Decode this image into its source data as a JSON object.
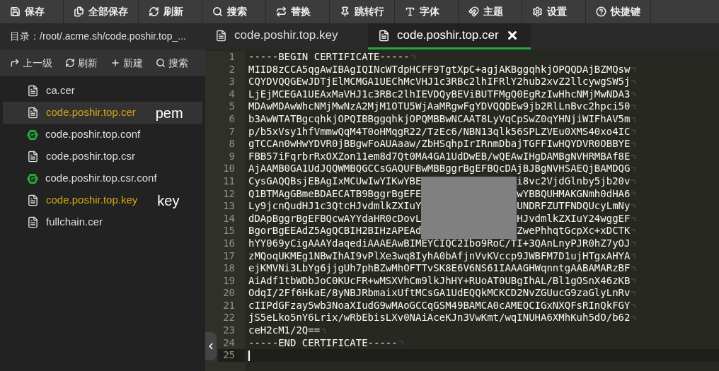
{
  "toolbar": [
    "保存",
    "全部保存",
    "刷新",
    "搜索",
    "替换",
    "跳转行",
    "字体",
    "主题",
    "设置",
    "快捷键"
  ],
  "sidebar": {
    "path": "目录：/root/.acme.sh/code.poshir.top_...",
    "actions": [
      "上一级",
      "刷新",
      "新建",
      "搜索"
    ],
    "files": [
      {
        "name": "ca.cer",
        "kind": "file",
        "selected": false,
        "open": false
      },
      {
        "name": "code.poshir.top.cer",
        "kind": "file",
        "selected": true,
        "open": true,
        "note": "pem"
      },
      {
        "name": "code.poshir.top.conf",
        "kind": "config",
        "selected": false,
        "open": false
      },
      {
        "name": "code.poshir.top.csr",
        "kind": "file",
        "selected": false,
        "open": false
      },
      {
        "name": "code.poshir.top.csr.conf",
        "kind": "config",
        "selected": false,
        "open": false
      },
      {
        "name": "code.poshir.top.key",
        "kind": "file",
        "selected": false,
        "open": true,
        "note": "key"
      },
      {
        "name": "fullchain.cer",
        "kind": "file",
        "selected": false,
        "open": false
      }
    ]
  },
  "tabs": [
    {
      "label": "code.poshir.top.key",
      "selected": false
    },
    {
      "label": "code.poshir.top.cer",
      "selected": true
    }
  ],
  "editor": {
    "lines": [
      {
        "number": "1",
        "kind": "text",
        "text": "-----BEGIN CERTIFICATE-----",
        "current": false
      },
      {
        "number": "2",
        "kind": "text",
        "text": "MIID8zCCA5qgAwIBAgIQINcWTdpHCFF9TgtXpC+agjAKBggqhkjOPQQDAjBZMQsw",
        "current": false
      },
      {
        "number": "3",
        "kind": "text",
        "text": "CQYDVQQGEwJDTjElMCMGA1UEChMcVHJ1c3RBc2lhIFRlY2hub2xvZ2llcywgSW5j",
        "current": false
      },
      {
        "number": "4",
        "kind": "text",
        "text": "LjEjMCEGA1UEAxMaVHJ1c3RBc2lhIEVDQyBEViBUTFMgQ0EgRzIwHhcNMjMwNDA3",
        "current": false
      },
      {
        "number": "5",
        "kind": "text",
        "text": "MDAwMDAwWhcNMjMwNzA2MjM1OTU5WjAaMRgwFgYDVQQDEw9jb2RlLnBvc2hpci50",
        "current": false
      },
      {
        "number": "6",
        "kind": "text",
        "text": "b3AwWTATBgcqhkjOPQIBBggqhkjOPQMBBwNCAAT8LyVqCpSwZ0qYHNjiWIFhAV5m",
        "current": false
      },
      {
        "number": "7",
        "kind": "text",
        "text": "p/b5xVsy1hfVmmwQqM4T0oHMqgR22/TzEc6/NBN13qlk56SPLZVEu0XMS40xo4IC",
        "current": false
      },
      {
        "number": "8",
        "kind": "text",
        "text": "gTCCAn0wHwYDVR0jBBgwFoAUAaaw/ZbHSqhpIrIRnmDbajTGFFIwHQYDVR0OBBYE",
        "current": false
      },
      {
        "number": "9",
        "kind": "text",
        "text": "FBB57iFqrbrRxOXZon11em8d7Qt0MA4GA1UdDwEB/wQEAwIHgDAMBgNVHRMBAf8E",
        "current": false
      },
      {
        "number": "10",
        "kind": "text",
        "text": "AjAAMB0GA1UdJQQWMBQGCCsGAQUFBwMBBggrBgEFBQcDAjBJBgNVHSAEQjBAMDQG",
        "current": false
      },
      {
        "number": "11",
        "kind": "redacted",
        "left": "CysGAQQBsjEBAgIxMCUwIwYIKwYBE",
        "right": "i8vc2VjdGlnby5jb20v",
        "current": false
      },
      {
        "number": "12",
        "kind": "redacted",
        "left": "Q1BTMAgGBmeBDAECATB9BggrBgEFE",
        "right": "wYBBQUHMAKGNmh0dHA6",
        "current": false
      },
      {
        "number": "13",
        "kind": "redacted",
        "left": "Ly9jcnQudHJ1c3QtcHJvdmlkZXIuY",
        "right": "UNDRFZUTFNDQUcyLmNy",
        "current": false
      },
      {
        "number": "14",
        "kind": "redacted",
        "left": "dDApBggrBgEFBQcwAYYdaHR0cDovL",
        "right": "HJvdmlkZXIuY24wggEF",
        "current": false
      },
      {
        "number": "15",
        "kind": "redacted",
        "left": "BgorBgEEAdZ5AgQCBIH2BIHzAPEAd",
        "right": "ZwePhhqtGcpXc+xDCTK",
        "current": false
      },
      {
        "number": "16",
        "kind": "text",
        "text": "hYY069yCigAAAYdaqediAAAEAwBIMEYCIQC2Ibo9RoC/TI+3QAnLnyPJR0hZ7yOJ",
        "current": false
      },
      {
        "number": "17",
        "kind": "text",
        "text": "zMQoqUKMEg1NBwIhAI9vPlXe3wq8IyhA0bAfjnVvKVccp9JWBFM7D1ujHTgxAHYA",
        "current": false
      },
      {
        "number": "18",
        "kind": "text",
        "text": "ejKMVNi3LbYg6jjgUh7phBZwMhOFTTvSK8E6V6NS61IAAAGHWqnntgAABAMARzBF",
        "current": false
      },
      {
        "number": "19",
        "kind": "text",
        "text": "AiAdf1tbWDbJoC0KUcFR+wMSXVhCm9lkJhHY+RUoAT0UBgIhAL/Bl1gOSnX46zKB",
        "current": false
      },
      {
        "number": "20",
        "kind": "text",
        "text": "OdqI/2Ff6HkaE/8yNBJRbmaixUftMCsGA1UdEQQkMCKCD2NvZGUucG9zaGlyLnRv",
        "current": false
      },
      {
        "number": "21",
        "kind": "text",
        "text": "cIIPdGFzay5wb3NoaXIudG9wMAoGCCqGSM49BAMCA0cAMEQCIGxNXQFsRInQkFGY",
        "current": false
      },
      {
        "number": "22",
        "kind": "text",
        "text": "jS5eLko5nY6Lrix/wRbEbisLXv0NAiAceKJn3VwKmt/wqINUHA6XMhKuh5dO/b62",
        "current": false
      },
      {
        "number": "23",
        "kind": "text",
        "text": "ceH2cM1/2Q==",
        "current": false
      },
      {
        "number": "24",
        "kind": "text",
        "text": "-----END CERTIFICATE-----",
        "current": false
      },
      {
        "number": "25",
        "kind": "empty",
        "current": true
      }
    ]
  }
}
